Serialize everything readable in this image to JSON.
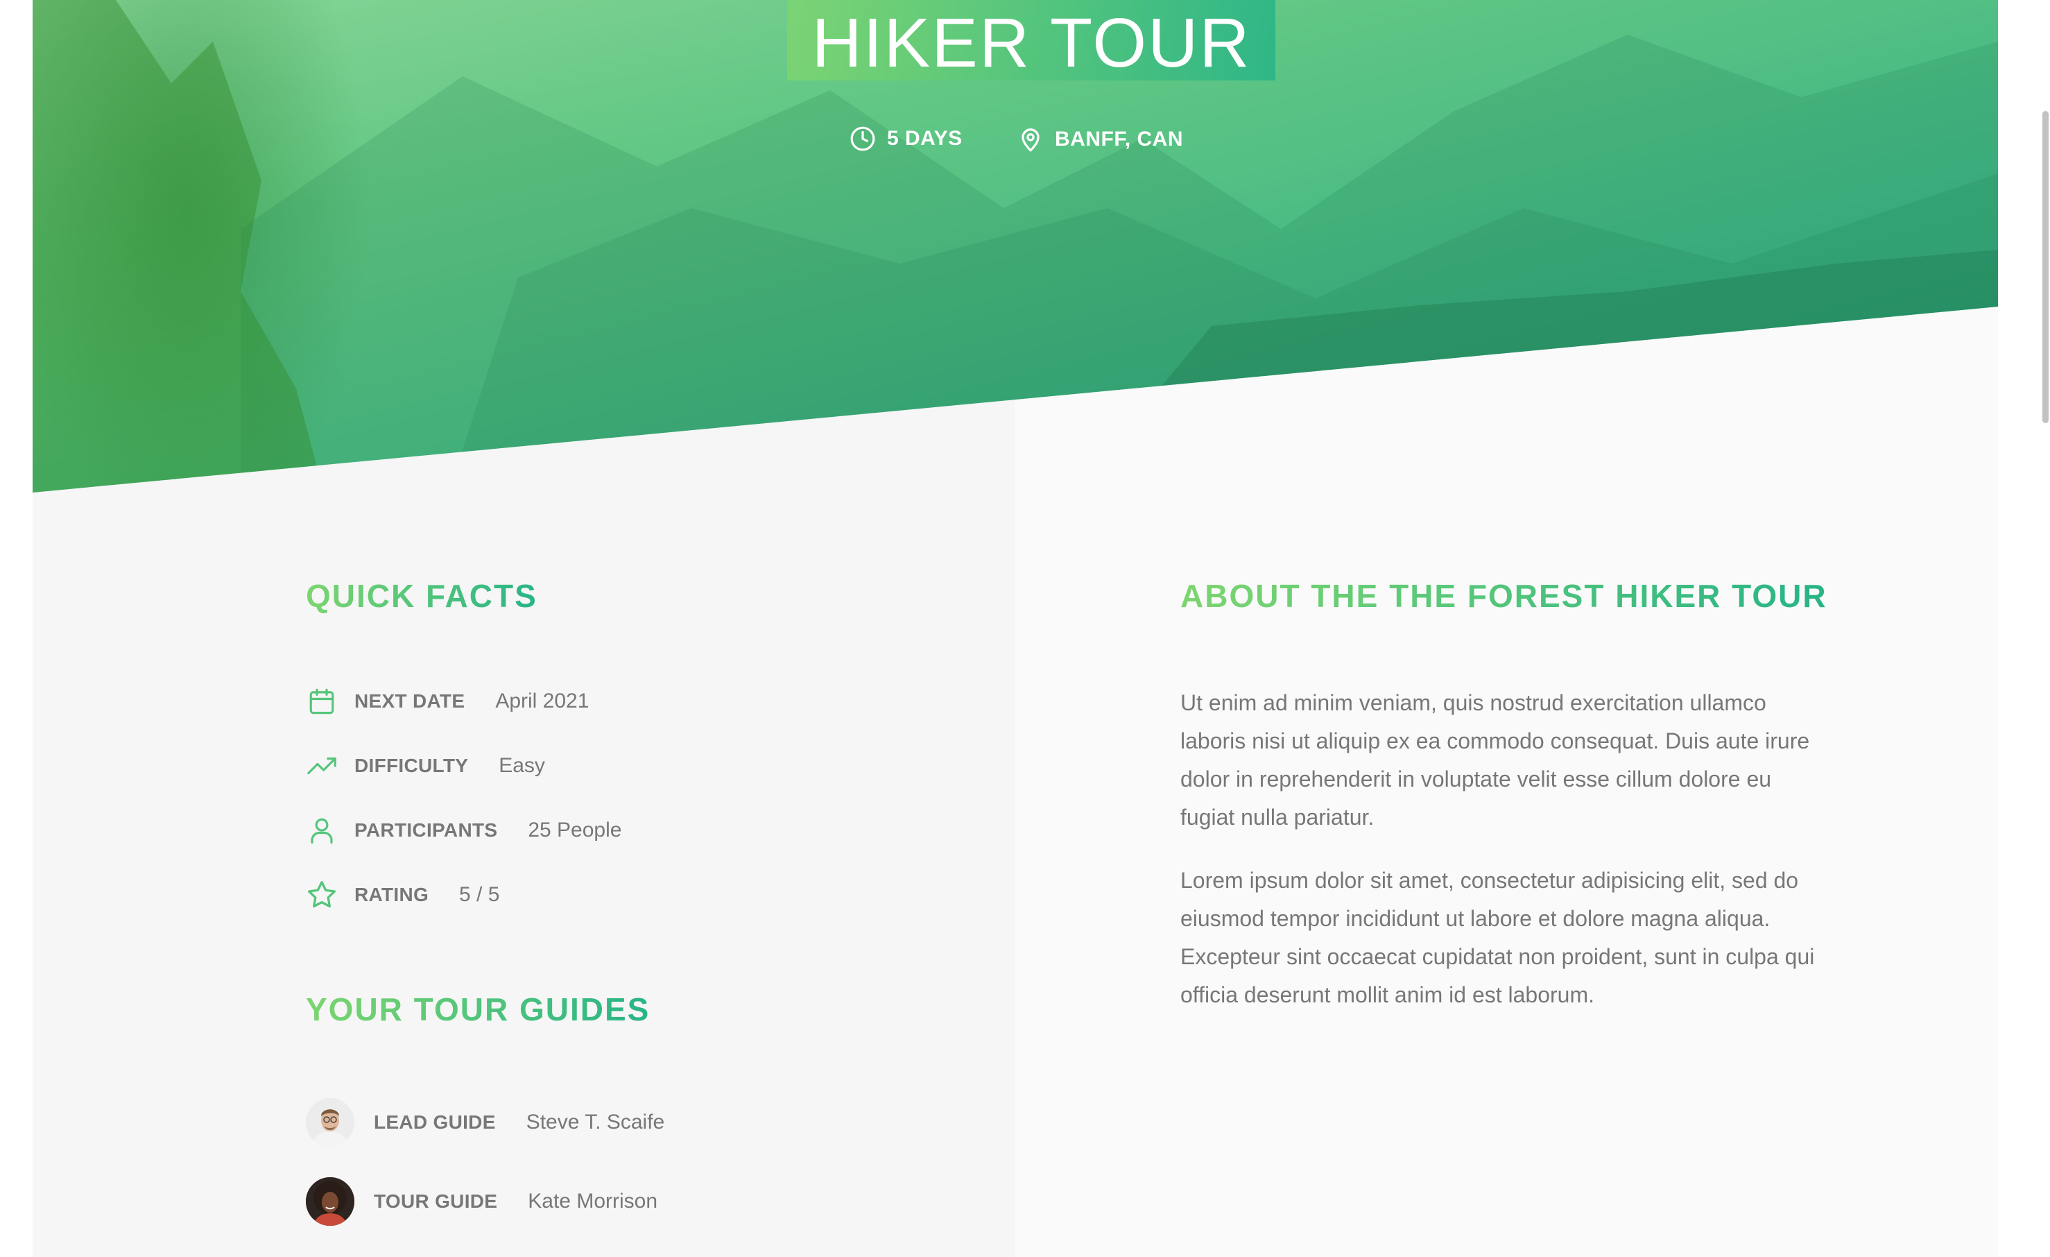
{
  "hero": {
    "title": "HIKER TOUR",
    "duration": "5 DAYS",
    "location": "BANFF, CAN",
    "duration_icon": "clock-icon",
    "location_icon": "map-pin-icon"
  },
  "quick_facts": {
    "heading": "QUICK FACTS",
    "items": [
      {
        "icon": "calendar-icon",
        "label": "NEXT DATE",
        "value": "April 2021"
      },
      {
        "icon": "trending-up-icon",
        "label": "DIFFICULTY",
        "value": "Easy"
      },
      {
        "icon": "user-icon",
        "label": "PARTICIPANTS",
        "value": "25 People"
      },
      {
        "icon": "star-icon",
        "label": "RATING",
        "value": "5 / 5"
      }
    ]
  },
  "guides": {
    "heading": "YOUR TOUR GUIDES",
    "items": [
      {
        "role": "LEAD GUIDE",
        "name": "Steve T. Scaife"
      },
      {
        "role": "TOUR GUIDE",
        "name": "Kate Morrison"
      }
    ]
  },
  "about": {
    "heading": "ABOUT THE THE FOREST HIKER TOUR",
    "paragraphs": [
      "Ut enim ad minim veniam, quis nostrud exercitation ullamco laboris nisi ut aliquip ex ea commodo consequat. Duis aute irure dolor in reprehenderit in voluptate velit esse cillum dolore eu fugiat nulla pariatur.",
      "Lorem ipsum dolor sit amet, consectetur adipisicing elit, sed do eiusmod tempor incididunt ut labore et dolore magna aliqua. Excepteur sint occaecat cupidatat non proident, sunt in culpa qui officia deserunt mollit anim id est laborum."
    ]
  },
  "colors": {
    "accent_start": "#7dd56f",
    "accent_end": "#28b487",
    "text": "#777777",
    "left_background": "#f6f6f6",
    "right_background": "#fafafa"
  }
}
